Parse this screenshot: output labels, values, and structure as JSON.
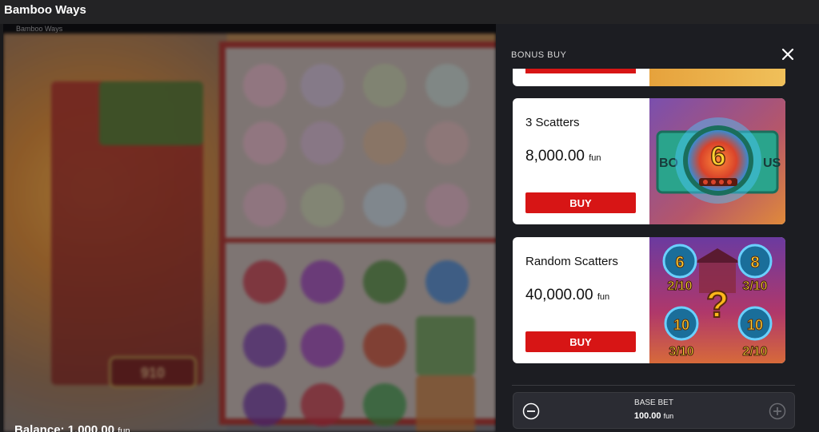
{
  "page": {
    "title": "Bamboo Ways"
  },
  "game": {
    "frame_label": "Bamboo Ways",
    "win_display": "910",
    "balance_label": "Balance:",
    "balance_value": "1,000.00",
    "balance_currency": "fun"
  },
  "bonus_buy": {
    "title": "BONUS BUY",
    "options": [
      {
        "name": "3 Scatters",
        "price": "8,000.00",
        "currency": "fun",
        "buy_label": "BUY",
        "image_badge": "6"
      },
      {
        "name": "Random Scatters",
        "price": "40,000.00",
        "currency": "fun",
        "buy_label": "BUY",
        "image_badges": [
          {
            "num": "6",
            "frac": "2/10"
          },
          {
            "num": "8",
            "frac": "3/10"
          },
          {
            "num": "10",
            "frac": "3/10"
          },
          {
            "num": "10",
            "frac": "2/10"
          }
        ],
        "image_center": "?"
      }
    ]
  },
  "base_bet": {
    "label": "BASE BET",
    "value": "100.00",
    "currency": "fun"
  },
  "colors": {
    "buy_button": "#d71515",
    "panel_bg": "#1c1d22",
    "card_bg": "#ffffff"
  },
  "icons": {
    "close": "close-icon",
    "minus": "minus-icon",
    "plus": "plus-icon"
  }
}
